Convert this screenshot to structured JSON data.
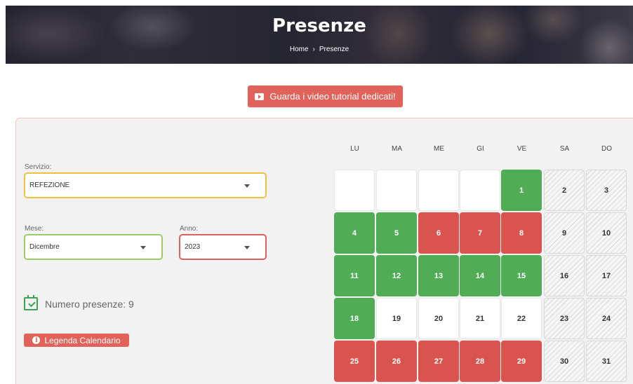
{
  "header": {
    "title": "Presenze",
    "breadcrumb": {
      "home": "Home",
      "separator": "›",
      "current": "Presenze"
    }
  },
  "tutorial_button": {
    "label": "Guarda i video tutorial dedicati!",
    "icon": "video-play-icon"
  },
  "filters": {
    "servizio": {
      "label": "Servizio:",
      "value": "REFEZIONE",
      "border_color": "#f0c040"
    },
    "mese": {
      "label": "Mese:",
      "value": "Dicembre",
      "border_color": "#9ccc65"
    },
    "anno": {
      "label": "Anno:",
      "value": "2023",
      "border_color": "#e06060"
    }
  },
  "presenze": {
    "text": "Numero presenze: 9",
    "icon": "calendar-check-icon"
  },
  "legend_button": {
    "label": "Legenda Calendario",
    "icon": "info-icon"
  },
  "colors": {
    "present": "#50ad55",
    "absent": "#d9534f",
    "accent": "#e0625b"
  },
  "calendar": {
    "weekdays": [
      "LU",
      "MA",
      "ME",
      "GI",
      "VE",
      "SA",
      "DO"
    ],
    "weeks": [
      [
        {
          "day": "",
          "status": "empty"
        },
        {
          "day": "",
          "status": "empty"
        },
        {
          "day": "",
          "status": "empty"
        },
        {
          "day": "",
          "status": "empty"
        },
        {
          "day": "1",
          "status": "present"
        },
        {
          "day": "2",
          "status": "weekend"
        },
        {
          "day": "3",
          "status": "weekend"
        }
      ],
      [
        {
          "day": "4",
          "status": "present"
        },
        {
          "day": "5",
          "status": "present"
        },
        {
          "day": "6",
          "status": "absent"
        },
        {
          "day": "7",
          "status": "absent"
        },
        {
          "day": "8",
          "status": "absent"
        },
        {
          "day": "9",
          "status": "weekend"
        },
        {
          "day": "10",
          "status": "weekend"
        }
      ],
      [
        {
          "day": "11",
          "status": "present"
        },
        {
          "day": "12",
          "status": "present"
        },
        {
          "day": "13",
          "status": "present"
        },
        {
          "day": "14",
          "status": "present"
        },
        {
          "day": "15",
          "status": "present"
        },
        {
          "day": "16",
          "status": "weekend"
        },
        {
          "day": "17",
          "status": "weekend"
        }
      ],
      [
        {
          "day": "18",
          "status": "present"
        },
        {
          "day": "19",
          "status": "none"
        },
        {
          "day": "20",
          "status": "none"
        },
        {
          "day": "21",
          "status": "none"
        },
        {
          "day": "22",
          "status": "none"
        },
        {
          "day": "23",
          "status": "weekend"
        },
        {
          "day": "24",
          "status": "weekend"
        }
      ],
      [
        {
          "day": "25",
          "status": "absent"
        },
        {
          "day": "26",
          "status": "absent"
        },
        {
          "day": "27",
          "status": "absent"
        },
        {
          "day": "28",
          "status": "absent"
        },
        {
          "day": "29",
          "status": "absent"
        },
        {
          "day": "30",
          "status": "weekend"
        },
        {
          "day": "31",
          "status": "weekend"
        }
      ]
    ]
  }
}
